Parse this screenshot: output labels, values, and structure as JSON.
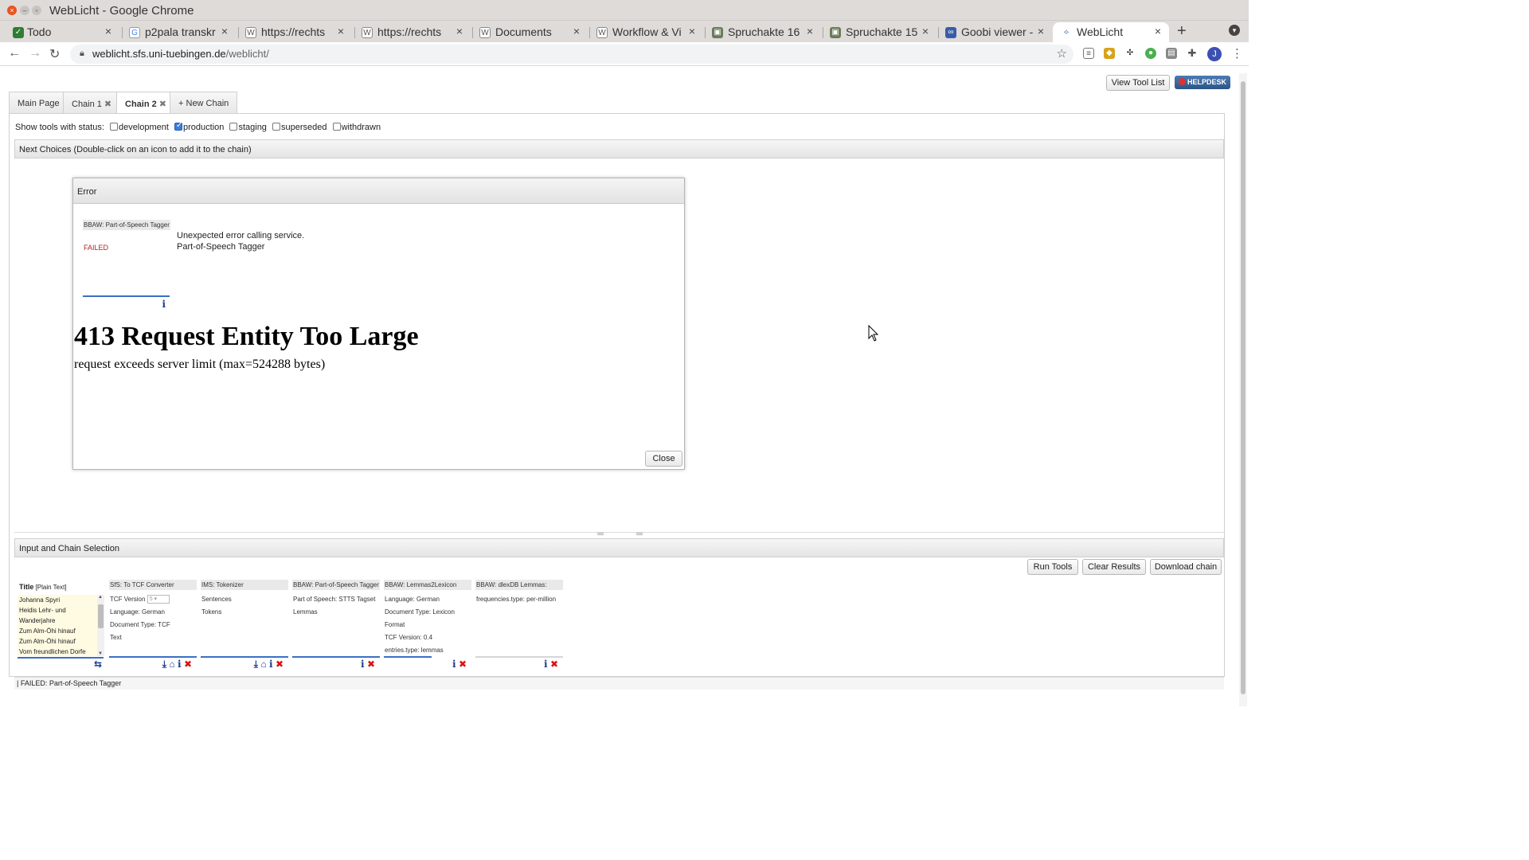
{
  "window": {
    "title": "WebLicht - Google Chrome"
  },
  "browser_tabs": [
    {
      "label": "Todo",
      "icon": "checkbox-icon"
    },
    {
      "label": "p2pala transkr",
      "icon": "google-icon"
    },
    {
      "label": "https://rechts",
      "icon": "wordpress-icon"
    },
    {
      "label": "https://rechts",
      "icon": "wordpress-icon"
    },
    {
      "label": "Documents",
      "icon": "wordpress-icon"
    },
    {
      "label": "Workflow & Vi",
      "icon": "wordpress-icon"
    },
    {
      "label": "Spruchakte 16",
      "icon": "image-icon"
    },
    {
      "label": "Spruchakte 15",
      "icon": "image-icon"
    },
    {
      "label": "Goobi viewer -",
      "icon": "goobi-icon"
    },
    {
      "label": "WebLicht",
      "icon": "weblicht-icon",
      "active": true
    }
  ],
  "address": {
    "host": "weblicht.sfs.uni-tuebingen.de",
    "path": "/weblicht/"
  },
  "header": {
    "view_tool_list": "View Tool List",
    "helpdesk": "HELPDESK"
  },
  "page_tabs": [
    {
      "label": "Main Page"
    },
    {
      "label": "Chain 1",
      "close": "✖"
    },
    {
      "label": "Chain 2",
      "close": "✖",
      "active": true
    },
    {
      "label": "New Chain",
      "prefix": "+"
    }
  ],
  "status_filter": {
    "label": "Show tools with status:",
    "options": [
      {
        "label": "development",
        "checked": false
      },
      {
        "label": "production",
        "checked": true
      },
      {
        "label": "staging",
        "checked": false
      },
      {
        "label": "superseded",
        "checked": false
      },
      {
        "label": "withdrawn",
        "checked": false
      }
    ]
  },
  "next_choices": {
    "title": "Next Choices (Double-click on an icon to add it to the chain)"
  },
  "error_dialog": {
    "title": "Error",
    "tool_name": "BBAW: Part-of-Speech Tagger",
    "tool_state": "FAILED",
    "message_line1": "Unexpected error calling service.",
    "message_line2": "Part-of-Speech Tagger",
    "http_title": "413 Request Entity Too Large",
    "http_detail": "request exceeds server limit (max=524288 bytes)",
    "close_label": "Close"
  },
  "input_chain": {
    "title": "Input and Chain Selection",
    "run_tools": "Run Tools",
    "clear_results": "Clear Results",
    "download_chain": "Download chain",
    "input": {
      "title": "Title",
      "format": "[Plain Text]",
      "lines": [
        "Johanna Spyri",
        "Heidis Lehr- und",
        "Wanderjahre",
        "Zum Alm-Öhi hinauf",
        "Zum Alm-Öhi hinauf",
        "Vom freundlichen Dorfe"
      ]
    },
    "tools": [
      {
        "name": "SfS: To TCF Converter",
        "params": [
          "TCF Version",
          "Language: German",
          "Document Type: TCF",
          "Text"
        ],
        "version_value": "5"
      },
      {
        "name": "IMS: Tokenizer",
        "params": [
          "Sentences",
          "Tokens"
        ]
      },
      {
        "name": "BBAW: Part-of-Speech Tagger",
        "params": [
          "Part of Speech: STTS Tagset",
          "Lemmas"
        ]
      },
      {
        "name": "BBAW: Lemmas2Lexicon",
        "params": [
          "Language: German",
          "Document Type: Lexicon Format",
          "TCF Version: 0.4",
          "entries.type: lemmas"
        ]
      },
      {
        "name": "BBAW: dlexDB Lemmas:",
        "params": [
          "frequencies.type: per-million"
        ]
      }
    ]
  },
  "status_bar": {
    "text": "| FAILED: Part-of-Speech Tagger"
  },
  "colors": {
    "failed": "#b22222",
    "accent": "#3b6fc4",
    "helpdesk": "#2b5589",
    "delete": "#dd1111"
  }
}
